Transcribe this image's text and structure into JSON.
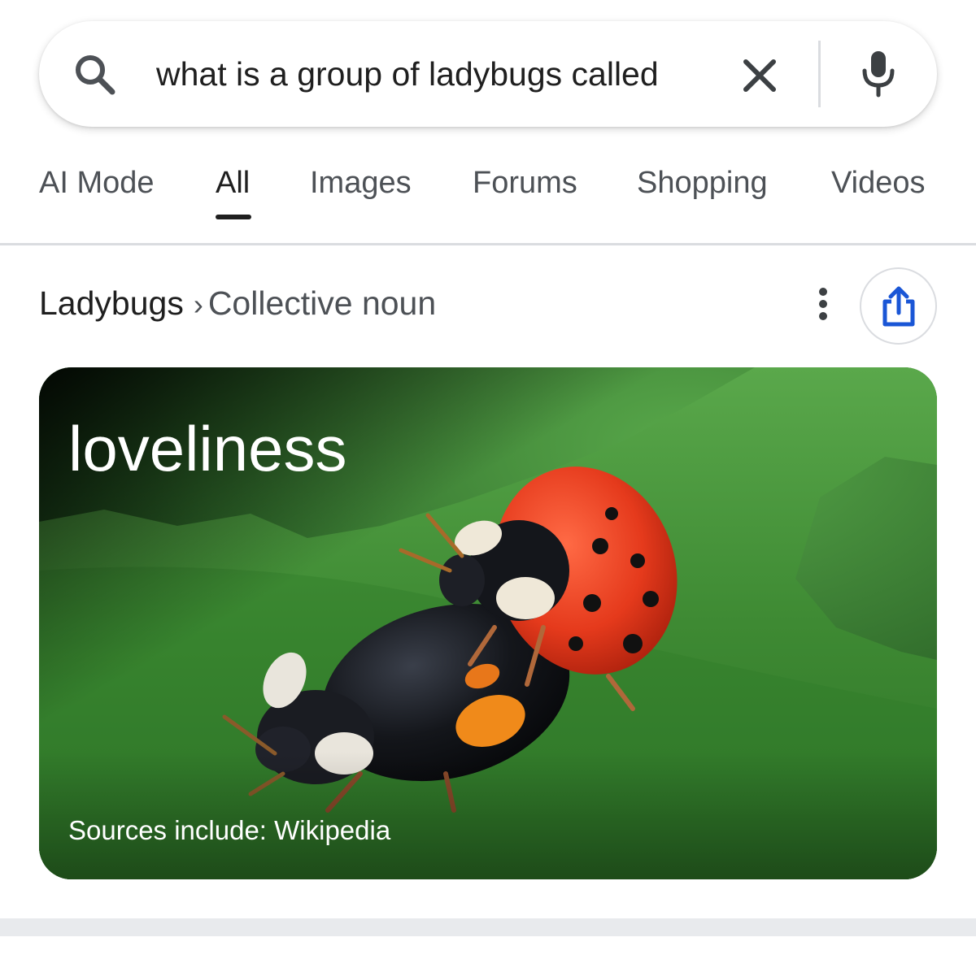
{
  "search": {
    "query": "what is a group of ladybugs called",
    "icons": {
      "search": "search-icon",
      "clear": "close-icon",
      "voice": "mic-icon"
    }
  },
  "tabs": [
    {
      "label": "AI Mode",
      "active": false
    },
    {
      "label": "All",
      "active": true
    },
    {
      "label": "Images",
      "active": false
    },
    {
      "label": "Forums",
      "active": false
    },
    {
      "label": "Shopping",
      "active": false
    },
    {
      "label": "Videos",
      "active": false
    }
  ],
  "breadcrumb": {
    "topic": "Ladybugs",
    "separator": "›",
    "attribute": "Collective noun"
  },
  "actions": {
    "more": "more-vert-icon",
    "share": "share-icon"
  },
  "answer_card": {
    "answer": "loveliness",
    "sources": "Sources include: Wikipedia",
    "image": "photo of two ladybugs on a green leaf"
  },
  "colors": {
    "text_primary": "#1f1f1f",
    "text_secondary": "#4d5156",
    "divider": "#dadce0",
    "share_blue": "#1a56d6",
    "leaf_green": "#3e8a33"
  }
}
